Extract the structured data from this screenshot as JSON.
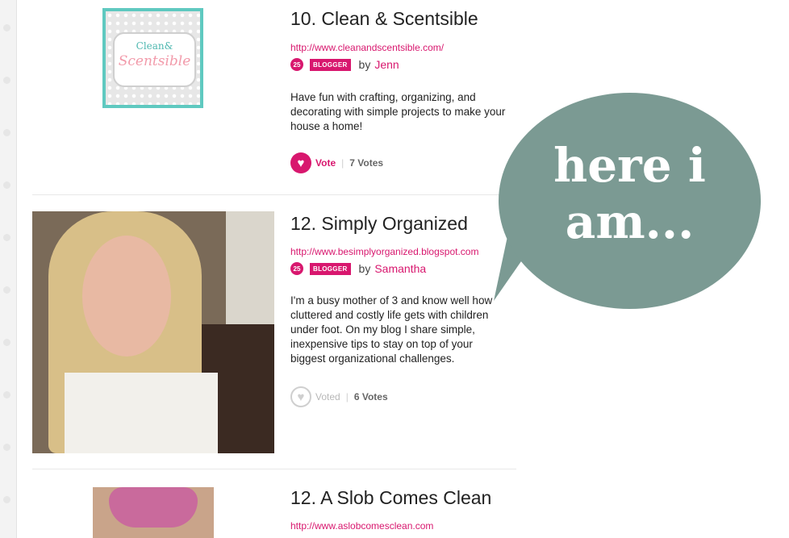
{
  "entries": [
    {
      "title": "10. Clean & Scentsible",
      "url": "http://www.cleanandscentsible.com/",
      "level": "25",
      "badge": "BLOGGER",
      "by": "by",
      "author": "Jenn",
      "description": "Have fun with crafting, organizing, and decorating with simple projects to make your house a home!",
      "vote_label": "Vote",
      "votes": "7 Votes",
      "logo_line1": "Clean&",
      "logo_line2": "Scentsible"
    },
    {
      "title": "12. Simply Organized",
      "url": "http://www.besimplyorganized.blogspot.com",
      "level": "25",
      "badge": "BLOGGER",
      "by": "by",
      "author": "Samantha",
      "description": "I'm a busy mother of 3 and know well how cluttered and costly life gets with children under foot. On my blog I share simple, inexpensive tips to stay on top of your biggest organizational challenges.",
      "vote_label": "Voted",
      "votes": "6 Votes"
    },
    {
      "title": "12. A Slob Comes Clean",
      "url": "http://www.aslobcomesclean.com"
    }
  ],
  "bubble": {
    "line1": "here i",
    "line2": "am..."
  },
  "colors": {
    "accent": "#d8176e",
    "bubble": "#7b9a93",
    "logo_frame": "#5fc9c0"
  },
  "icons": {
    "vote": "heart-icon"
  }
}
